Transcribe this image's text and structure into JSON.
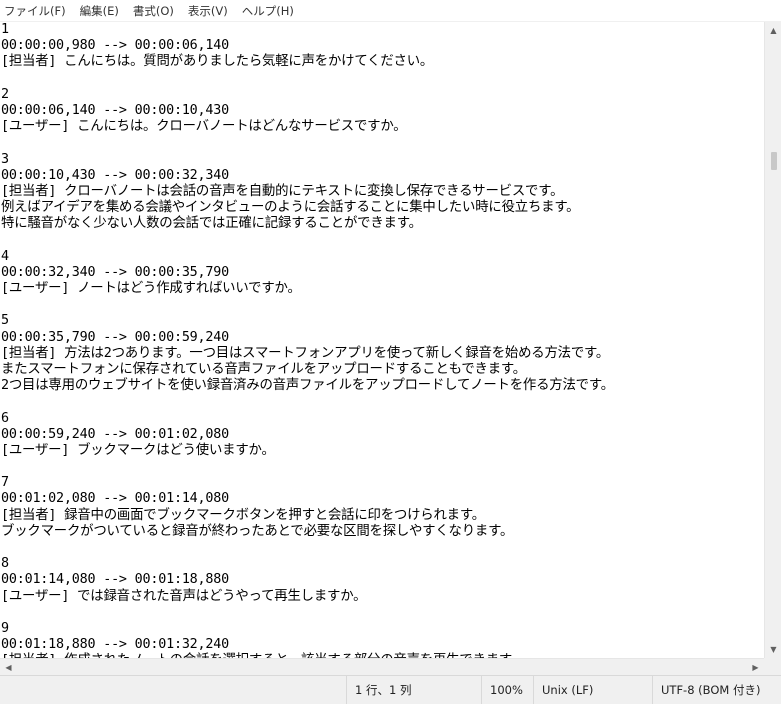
{
  "menu": {
    "items": [
      "ファイル(F)",
      "編集(E)",
      "書式(O)",
      "表示(V)",
      "ヘルプ(H)"
    ]
  },
  "document": {
    "lines": [
      "1",
      "00:00:00,980 --> 00:00:06,140",
      "[担当者] こんにちは。質問がありましたら気軽に声をかけてください。",
      "",
      "2",
      "00:00:06,140 --> 00:00:10,430",
      "[ユーザー] こんにちは。クローバノートはどんなサービスですか。",
      "",
      "3",
      "00:00:10,430 --> 00:00:32,340",
      "[担当者] クローバノートは会話の音声を自動的にテキストに変換し保存できるサービスです。",
      "例えばアイデアを集める会議やインタビューのように会話することに集中したい時に役立ちます。",
      "特に騒音がなく少ない人数の会話では正確に記録することができます。",
      "",
      "4",
      "00:00:32,340 --> 00:00:35,790",
      "[ユーザー] ノートはどう作成すればいいですか。",
      "",
      "5",
      "00:00:35,790 --> 00:00:59,240",
      "[担当者] 方法は2つあります。一つ目はスマートフォンアプリを使って新しく録音を始める方法です。",
      "またスマートフォンに保存されている音声ファイルをアップロードすることもできます。",
      "2つ目は専用のウェブサイトを使い録音済みの音声ファイルをアップロードしてノートを作る方法です。",
      "",
      "6",
      "00:00:59,240 --> 00:01:02,080",
      "[ユーザー] ブックマークはどう使いますか。",
      "",
      "7",
      "00:01:02,080 --> 00:01:14,080",
      "[担当者] 録音中の画面でブックマークボタンを押すと会話に印をつけられます。",
      "ブックマークがついていると録音が終わったあとで必要な区間を探しやすくなります。",
      "",
      "8",
      "00:01:14,080 --> 00:01:18,880",
      "[ユーザー] では録音された音声はどうやって再生しますか。",
      "",
      "9",
      "00:01:18,880 --> 00:01:32,240",
      "[担当者] 作成されたノートの会話を選択すると、該当する部分の音声を再生できます。"
    ]
  },
  "statusbar": {
    "position": "1 行、1 列",
    "zoom": "100%",
    "line_ending": "Unix (LF)",
    "encoding": "UTF-8 (BOM 付き)"
  },
  "icons": {
    "scroll_up": "chevron-up-icon",
    "scroll_down": "chevron-down-icon",
    "scroll_left": "chevron-left-icon",
    "scroll_right": "chevron-right-icon"
  }
}
